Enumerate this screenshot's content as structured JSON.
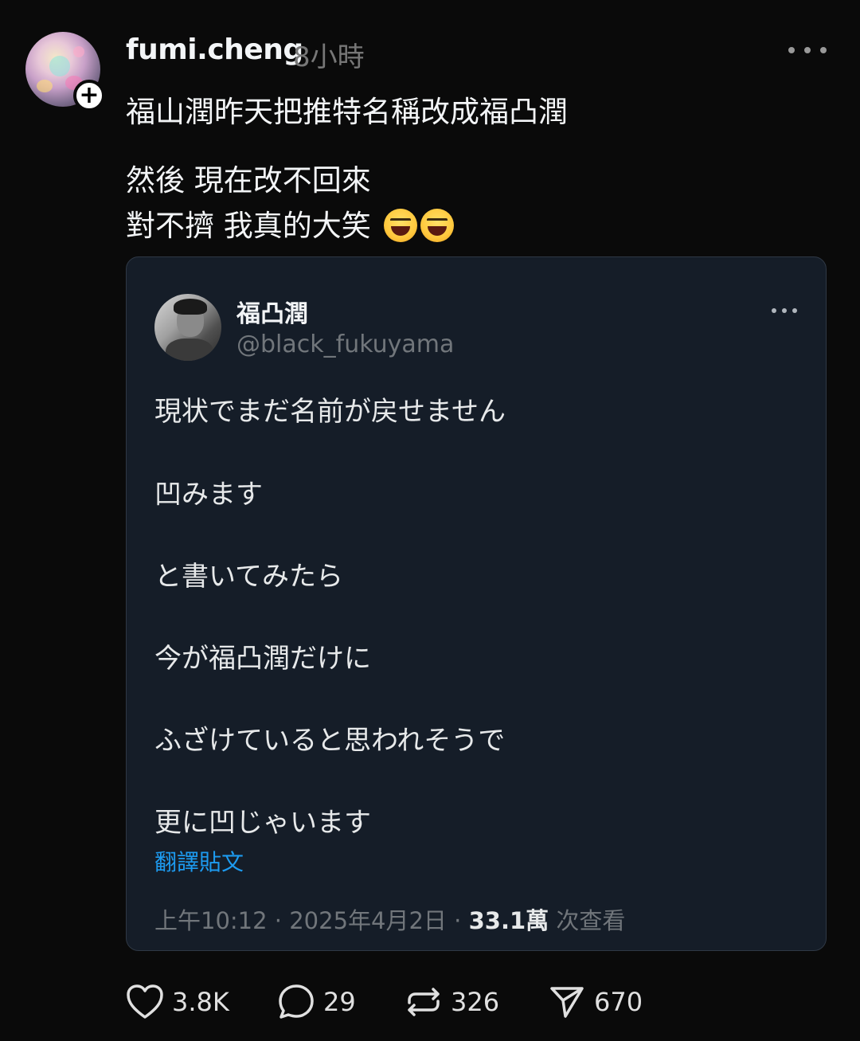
{
  "post": {
    "username": "fumi.cheng",
    "time": "8小時",
    "caption_lines": [
      "福山潤昨天把推特名稱改成福凸潤",
      "然後 現在改不回來",
      "對不擠 我真的大笑"
    ],
    "emojis": [
      "laughing-face",
      "laughing-face"
    ]
  },
  "quote": {
    "display_name": "福凸潤",
    "handle": "@black_fukuyama",
    "lines": [
      "現状でまだ名前が戻せません",
      "凹みます",
      "と書いてみたら",
      "今が福凸潤だけに",
      "ふざけていると思われそうで",
      "更に凹じゃいます"
    ],
    "translate_label": "翻譯貼文",
    "meta_time": "上午10:12 · 2025年4月2日 · ",
    "views_count": "33.1萬",
    "views_label": " 次查看"
  },
  "actions": {
    "likes": "3.8K",
    "comments": "29",
    "reposts": "326",
    "shares": "670"
  },
  "colors": {
    "background": "#0a0a0a",
    "card_background": "#151d28",
    "link": "#1d9bf0",
    "muted": "#71767b"
  }
}
